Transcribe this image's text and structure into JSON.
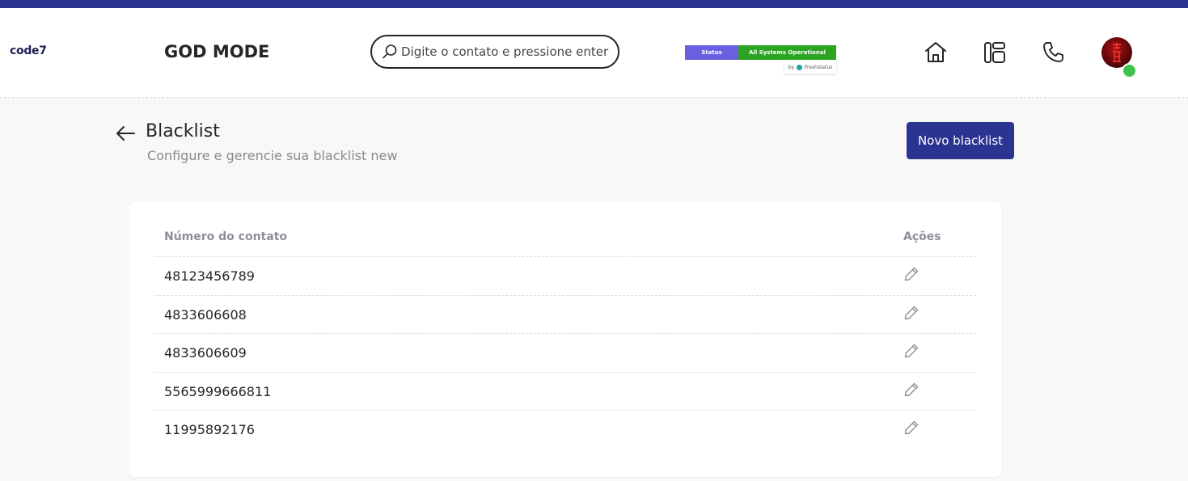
{
  "header": {
    "logo": "code7",
    "mode_title": "GOD MODE",
    "search": {
      "placeholder": "Digite o contato e pressione enter",
      "value": ""
    },
    "status_widget": {
      "label": "Status",
      "value": "All Systems Operational",
      "provider_by": "by",
      "provider": "Freshstatus"
    },
    "nav": [
      {
        "icon": "home-icon"
      },
      {
        "icon": "layout-icon"
      },
      {
        "icon": "phone-icon"
      }
    ],
    "user": {
      "presence": "online",
      "presence_color": "#3fc24a"
    }
  },
  "page": {
    "title": "Blacklist",
    "subtitle": "Configure e gerencie sua blacklist new",
    "new_button": "Novo blacklist"
  },
  "table": {
    "columns": [
      "Número do contato",
      "Ações"
    ],
    "rows": [
      {
        "number": "48123456789"
      },
      {
        "number": "4833606608"
      },
      {
        "number": "4833606609"
      },
      {
        "number": "5565999666811"
      },
      {
        "number": "11995892176"
      }
    ]
  },
  "colors": {
    "accent": "#2b3491",
    "status_label": "#6a5fe0",
    "status_ok": "#2aa421"
  }
}
